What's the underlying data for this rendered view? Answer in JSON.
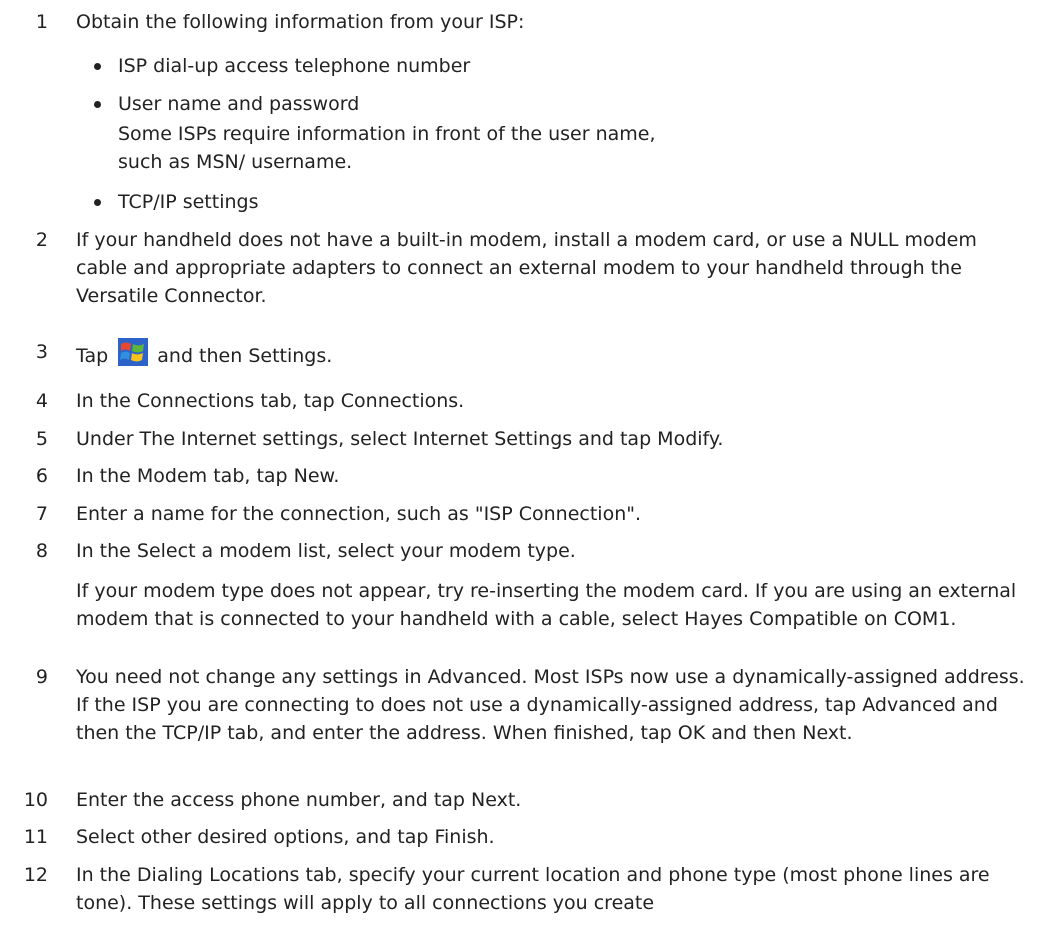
{
  "steps": [
    {
      "number": "1",
      "text": "Obtain the following information from your ISP:",
      "bullets": [
        {
          "text": "ISP dial-up access telephone number"
        },
        {
          "text": "User name and password",
          "note": "Some ISPs require information in front of the user name, such as MSN/ username."
        },
        {
          "text": "TCP/IP settings"
        }
      ]
    },
    {
      "number": "2",
      "text": "If your handheld does not have a built-in modem, install a modem card, or use a NULL modem cable and appropriate adapters to connect an external modem to your handheld through the Versatile Connector."
    },
    {
      "number": "3",
      "text_before_icon": "Tap",
      "icon": "windows-start-icon",
      "text_after_icon": "and then Settings."
    },
    {
      "number": "4",
      "text": "In the Connections tab, tap Connections."
    },
    {
      "number": "5",
      "text": "Under The Internet settings, select Internet Settings and tap Modify."
    },
    {
      "number": "6",
      "text": "In the Modem tab, tap New."
    },
    {
      "number": "7",
      "text": "Enter a name for the connection, such as \"ISP Connection\"."
    },
    {
      "number": "8",
      "text": "In the Select a modem list, select your modem type.",
      "note": "If your modem type does not appear, try re-inserting the modem card. If you are using an external modem that is connected to your handheld with a cable, select Hayes Compatible on COM1."
    },
    {
      "number": "9",
      "text": "You need not change any settings in Advanced. Most ISPs now use a dynamically-assigned address. If the ISP you are connecting to does not use a dynamically-assigned address, tap Advanced and then the TCP/IP tab, and enter the address. When finished, tap OK and then Next."
    },
    {
      "number": "10",
      "text": "Enter the access phone number, and tap Next."
    },
    {
      "number": "11",
      "text": "Select other desired options, and tap Finish."
    },
    {
      "number": "12",
      "text": "In the Dialing Locations tab, specify your current location and phone type (most phone lines are tone). These settings will apply to all connections you create"
    }
  ]
}
